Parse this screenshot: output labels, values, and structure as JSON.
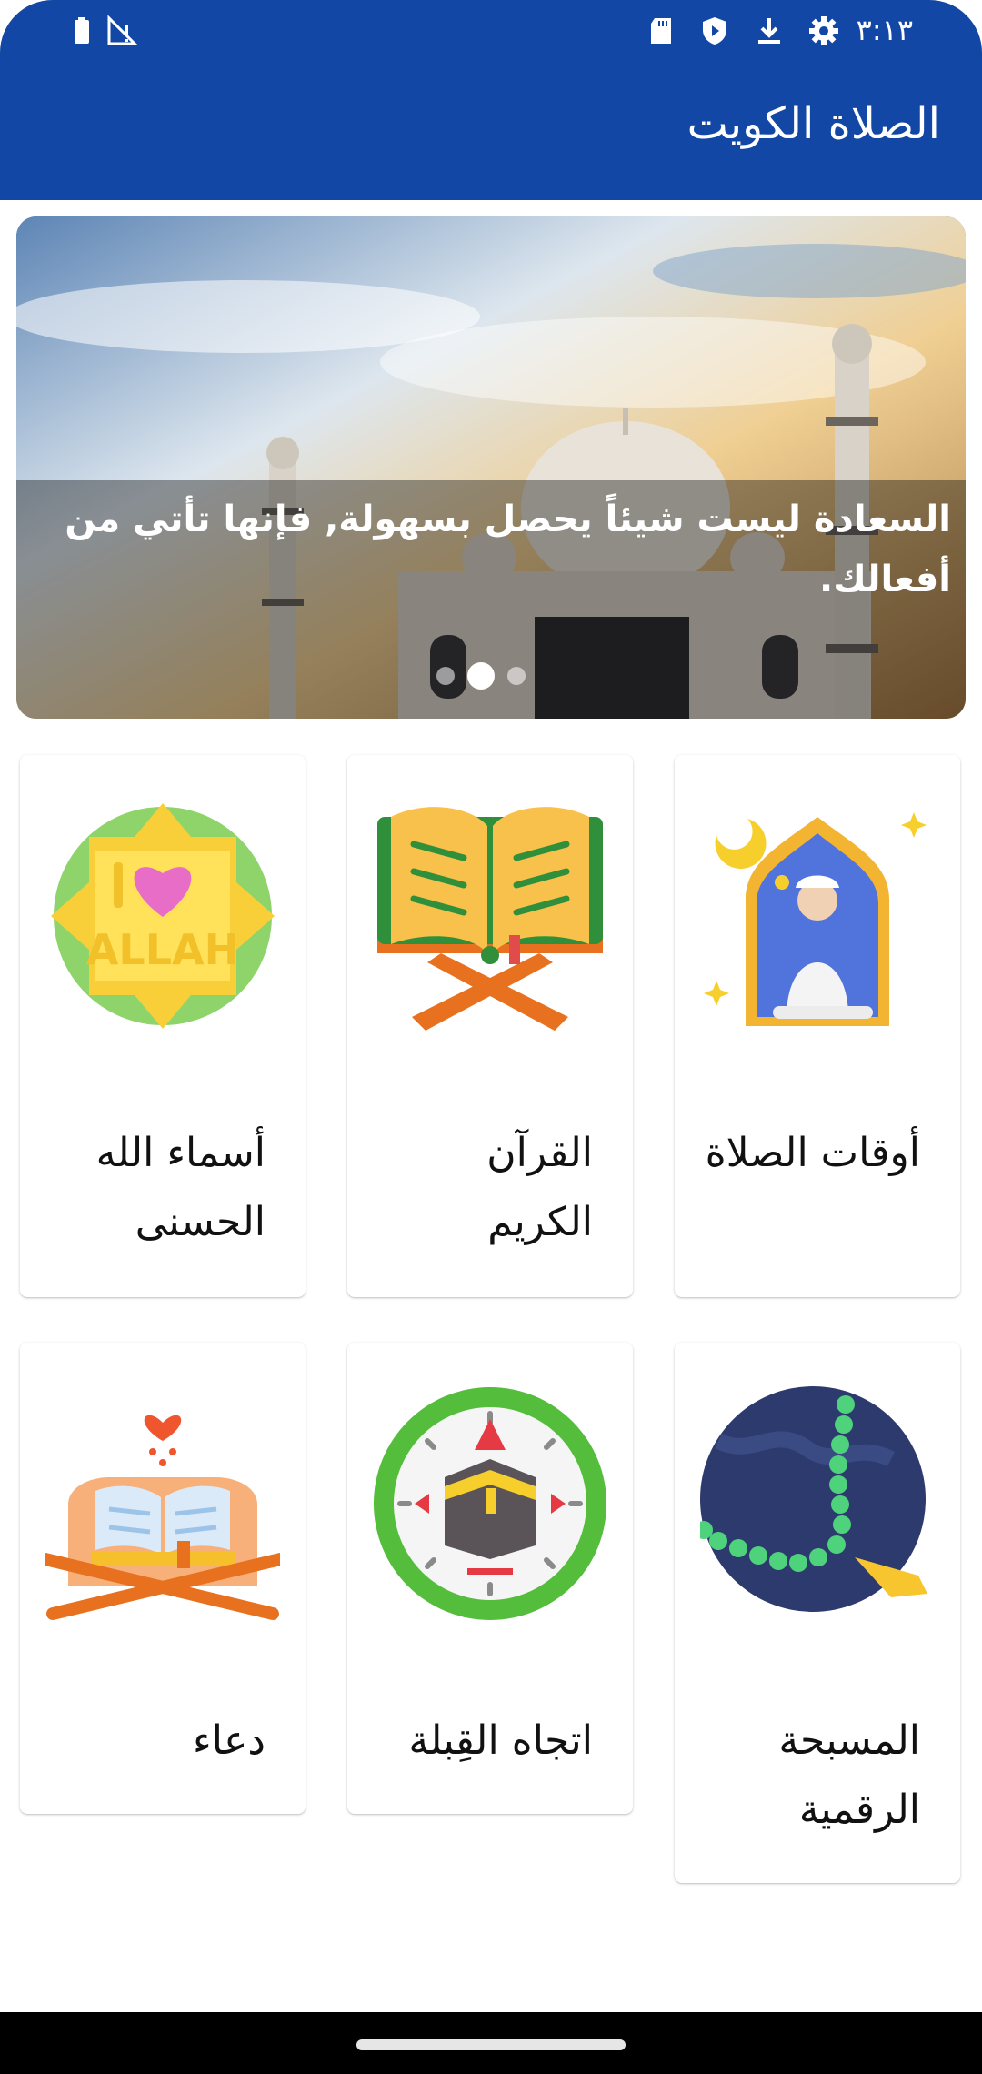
{
  "status_bar": {
    "time": "٣:١٣",
    "icons": [
      "settings-icon",
      "download-icon",
      "shield-icon",
      "sd-card-icon",
      "no-signal-icon",
      "battery-icon"
    ]
  },
  "app_bar": {
    "title": "الصلاة الكويت"
  },
  "slider": {
    "caption": "السعادة ليست شيئاً يحصل بسهولة, فإنها تأتي من أفعالك.",
    "dots": 3,
    "active_dot": 2
  },
  "grid": {
    "items": [
      {
        "label": "أوقات الصلاة",
        "icon": "prayer-times-icon"
      },
      {
        "label": "القرآن الكريم",
        "icon": "quran-icon"
      },
      {
        "label": "أسماء الله الحسنى",
        "icon": "allah-names-icon"
      },
      {
        "label": "المسبحة الرقمية",
        "icon": "tasbih-icon"
      },
      {
        "label": "اتجاه القِبلة",
        "icon": "qibla-compass-icon"
      },
      {
        "label": "دعاء",
        "icon": "dua-book-icon"
      }
    ]
  },
  "colors": {
    "primary": "#1347a5",
    "background": "#ffffff"
  }
}
